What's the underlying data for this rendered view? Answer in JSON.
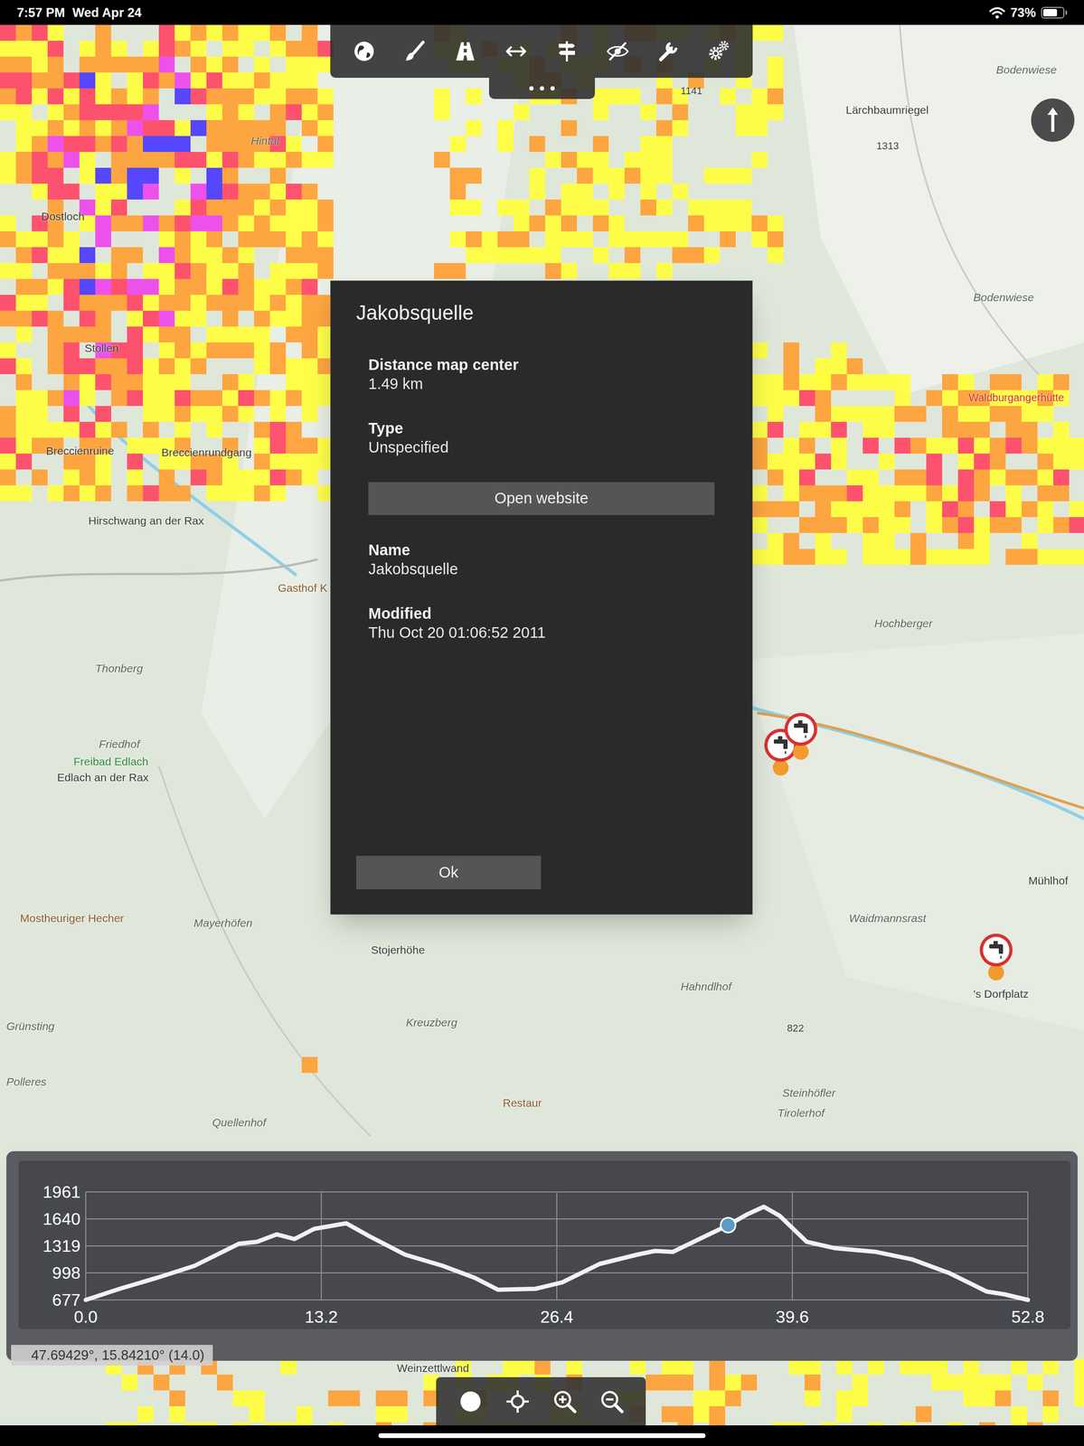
{
  "status_bar": {
    "time": "7:57 PM",
    "date": "Wed Apr 24",
    "battery": "73%",
    "battery_level": 0.73
  },
  "map": {
    "labels": [
      {
        "text": "Lärchbaumriegel",
        "kind": "settlement"
      },
      {
        "text": "1313",
        "kind": "peak"
      },
      {
        "text": "1141",
        "kind": "peak"
      },
      {
        "text": "Bodenwiese",
        "kind": "area"
      },
      {
        "text": "Bodenwiese",
        "kind": "area"
      },
      {
        "text": "Waldburgangerhütte",
        "kind": "hut"
      },
      {
        "text": "Hintal",
        "kind": "area"
      },
      {
        "text": "Dostloch",
        "kind": "settlement"
      },
      {
        "text": "Stollen",
        "kind": "settlement"
      },
      {
        "text": "Breccienruine",
        "kind": "settlement"
      },
      {
        "text": "Breccienrundgang",
        "kind": "settlement"
      },
      {
        "text": "Hirschwang an der Rax",
        "kind": "settlement"
      },
      {
        "text": "Gasthof K",
        "kind": "poi"
      },
      {
        "text": "Thonberg",
        "kind": "area"
      },
      {
        "text": "Friedhof",
        "kind": "area"
      },
      {
        "text": "Freibad Edlach",
        "kind": "bath"
      },
      {
        "text": "Edlach an der Rax",
        "kind": "settlement"
      },
      {
        "text": "Hochberger",
        "kind": "area"
      },
      {
        "text": "Mostheuriger Hecher",
        "kind": "poi"
      },
      {
        "text": "Mayerhöfen",
        "kind": "area"
      },
      {
        "text": "Stojerhöhe",
        "kind": "settlement"
      },
      {
        "text": "Waidmannsrast",
        "kind": "area"
      },
      {
        "text": "Mühlhof",
        "kind": "settlement"
      },
      {
        "text": "Hahndlhof",
        "kind": "area"
      },
      {
        "text": "822",
        "kind": "peak"
      },
      {
        "text": "Kreuzberg",
        "kind": "area"
      },
      {
        "text": "Grünsting",
        "kind": "area"
      },
      {
        "text": "Polleres",
        "kind": "area"
      },
      {
        "text": "Restaur",
        "kind": "poi"
      },
      {
        "text": "Steinhöfler",
        "kind": "area"
      },
      {
        "text": "Tirolerhof",
        "kind": "area"
      },
      {
        "text": "Quellenhof",
        "kind": "area"
      },
      {
        "text": "'s Dorfplatz",
        "kind": "settlement"
      },
      {
        "text": "Weinzettlwand",
        "kind": "settlement"
      }
    ],
    "pins": [
      {
        "kind": "water_tap"
      },
      {
        "kind": "water_tap"
      },
      {
        "kind": "water_tap"
      }
    ]
  },
  "dialog": {
    "title": "Jakobsquelle",
    "fields": [
      {
        "kind": "field",
        "label": "Distance map center",
        "value": "1.49 km"
      },
      {
        "kind": "field",
        "label": "Type",
        "value": "Unspecified"
      },
      {
        "kind": "button",
        "label": "Open website"
      },
      {
        "kind": "field",
        "label": "Name",
        "value": "Jakobsquelle"
      },
      {
        "kind": "field",
        "label": "Modified",
        "value": "Thu Oct 20 01:06:52 2011"
      }
    ],
    "buttons": [
      "Ok"
    ]
  },
  "elevation_chart": {
    "y_ticks": [
      "1961",
      "1640",
      "1319",
      "998",
      "677"
    ],
    "x_ticks": [
      "0.0",
      "13.2",
      "26.4",
      "39.6",
      "52.8"
    ],
    "profile": {
      "distance": [
        0,
        1.9,
        4.0,
        6.1,
        8.6,
        9.6,
        10.7,
        11.7,
        12.8,
        14.6,
        15.9,
        17.9,
        20.0,
        21.8,
        23.1,
        25.2,
        26.7,
        28.8,
        30.9,
        31.9,
        32.9,
        34.5,
        36.0,
        37.1,
        38.0,
        38.9,
        40.4,
        42.0,
        44.3,
        46.3,
        48.4,
        50.5,
        51.5,
        52.8
      ],
      "elevation": [
        677,
        809,
        940,
        1083,
        1346,
        1368,
        1456,
        1401,
        1522,
        1588,
        1434,
        1215,
        1083,
        940,
        798,
        809,
        886,
        1105,
        1215,
        1259,
        1248,
        1412,
        1566,
        1698,
        1785,
        1676,
        1368,
        1292,
        1248,
        1160,
        996,
        776,
        743,
        677
      ]
    },
    "cursor": {
      "distance": 36.0,
      "elevation": 1566
    }
  },
  "coordinates": "47.69429°, 15.84210° (14.0)"
}
